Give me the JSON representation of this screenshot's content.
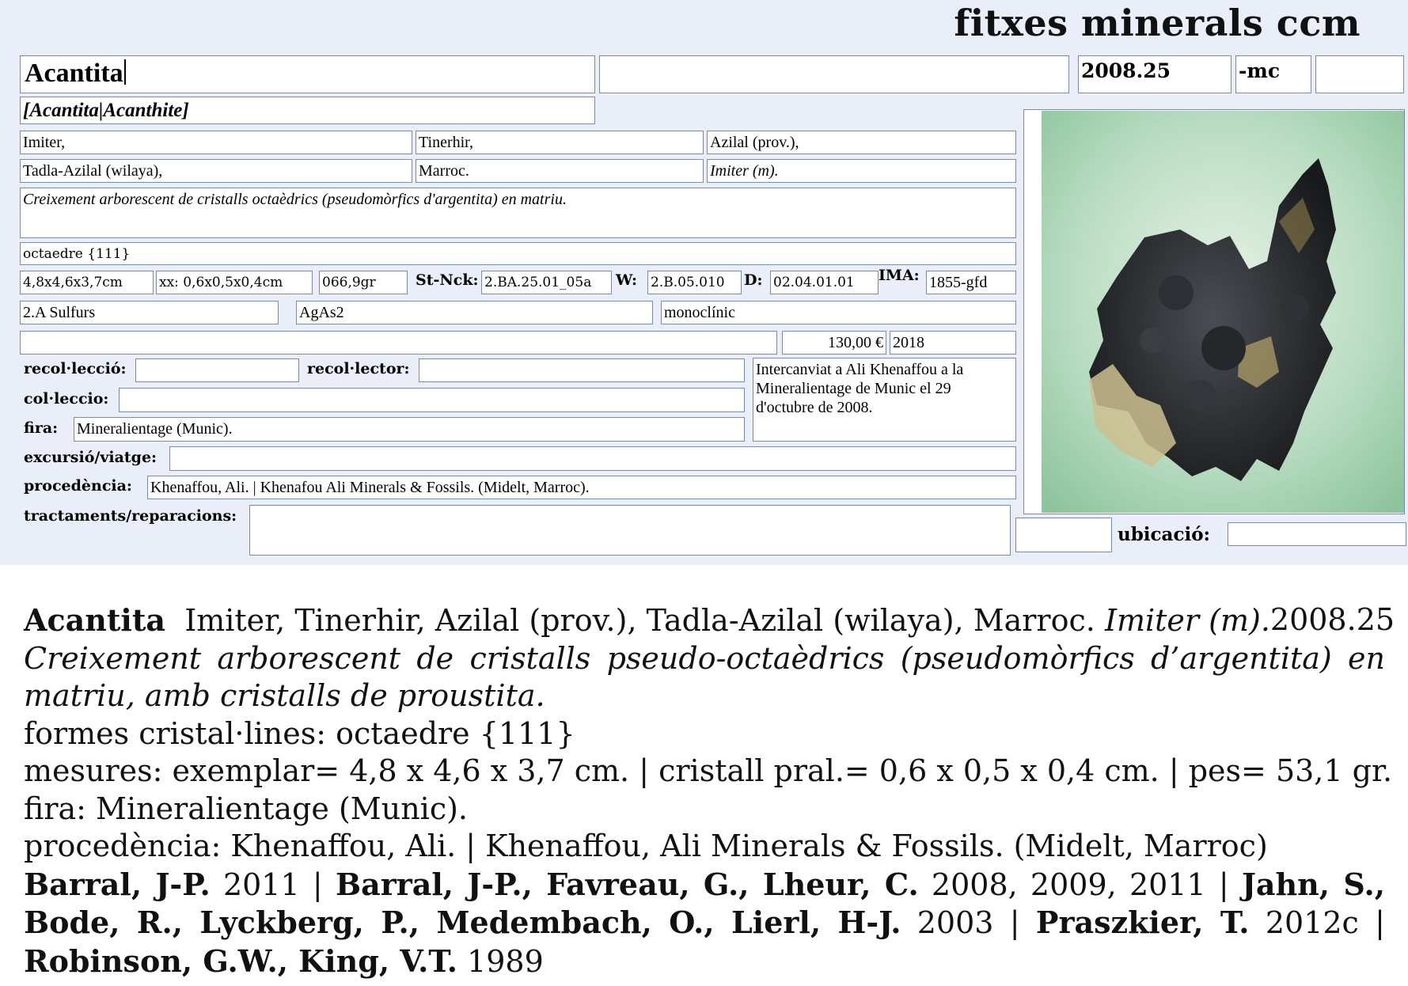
{
  "brand": "fitxes minerals ccm",
  "card": {
    "name": "Acantita",
    "name_extra": "",
    "code": "2008.25",
    "suffix": "-mc",
    "code_extra": "",
    "synonyms": "[Acantita|Acanthite]",
    "locality": [
      "Imiter,",
      "Tinerhir,",
      "Azilal (prov.),",
      "Tadla-Azilal (wilaya),",
      "Marroc.",
      "Imiter (m)."
    ],
    "description": "Creixement arborescent de cristalls octaèdrics (pseudomòrfics d'argentita) en matriu.",
    "forms": "octaedre {111}",
    "size": "4,8x4,6x3,7cm",
    "crystal_size": "xx: 0,6x0,5x0,4cm",
    "weight": "066,9gr",
    "strunz_label": "St-Nck:",
    "strunz": "2.BA.25.01_05a",
    "w_label": "W:",
    "w_value": "2.B.05.010",
    "d_label": "D:",
    "d_value": "02.04.01.01",
    "ima_label": "IMA:",
    "ima_value": "1855-gfd",
    "class": "2.A Sulfurs",
    "formula": "AgAs2",
    "system": "monoclínic",
    "misc": "",
    "price": "130,00 €",
    "year": "2018",
    "recollection_label": "recol·lecció:",
    "recollection": "",
    "collector_label": "recol·lector:",
    "collector": "",
    "collection_label": "col·leccio:",
    "collection": "",
    "fair_label": "fira:",
    "fair": "Mineralientage (Munic).",
    "notes": "Intercanviat a Ali Khenaffou a la Mineralientage de Munic el 29 d'octubre de 2008.",
    "trip_label": "excursió/viatge:",
    "trip": "",
    "origin_label": "procedència:",
    "origin": "Khenaffou, Ali. | Khenafou Ali Minerals & Fossils. (Midelt, Marroc).",
    "treatment_label": "tractaments/reparacions:",
    "treatment": "",
    "location_code": "",
    "location_label": "ubicació:",
    "location": "",
    "photo_bg": "#b8dcc0",
    "photo_mineral": "#2a2c2e"
  },
  "summary": {
    "name": "Acantita",
    "locality": "Imiter, Tinerhir, Azilal (prov.), Tadla-Azilal (wilaya), Marroc.",
    "mine": "Imiter (m).",
    "code": "2008.25",
    "description_a": "Creixement arborescent de cristalls pseudo-octaèdrics (pseudomòrfics d’argentita) en",
    "description_b": "matriu, amb cristalls de proustita.",
    "forms": "formes cristal·lines: octaedre {111}",
    "measures": "mesures: exemplar= 4,8 x 4,6 x 3,7 cm. | cristall pral.= 0,6 x 0,5 x 0,4 cm. | pes= 53,1 gr.",
    "fair": "fira: Mineralientage (Munic).",
    "origin": "procedència: Khenaffou, Ali. | Khenaffou, Ali Minerals & Fossils. (Midelt, Marroc)",
    "refs": [
      {
        "author": "Barral, J-P.",
        "years": "2011"
      },
      {
        "author": "Barral, J-P., Favreau, G., Lheur, C.",
        "years": "2008, 2009, 2011"
      },
      {
        "author": "Jahn, S.,",
        "years": ""
      },
      {
        "author": "Bode, R., Lyckberg, P., Medembach, O., Lierl, H-J.",
        "years": "2003"
      },
      {
        "author": "Praszkier, T.",
        "years": "2012c"
      },
      {
        "author": "Robinson, G.W., King, V.T.",
        "years": "1989"
      }
    ],
    "separator": "|"
  }
}
